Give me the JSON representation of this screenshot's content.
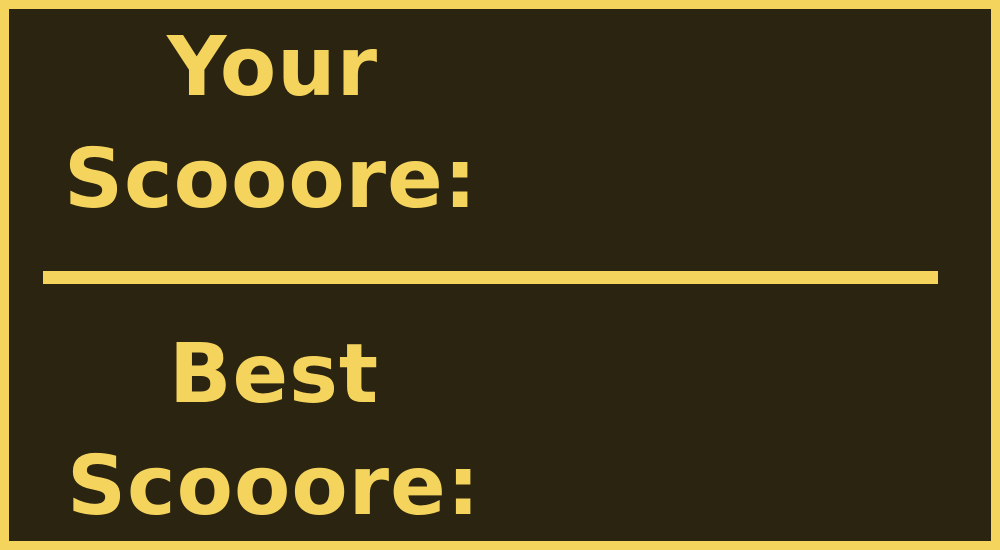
{
  "colors": {
    "background": "#2a2410",
    "accent": "#f5d45e"
  },
  "score_panel": {
    "your_score": {
      "line1": "Your",
      "line2": "Scooore:",
      "value": ""
    },
    "best_score": {
      "line1": "Best",
      "line2": "Scooore:",
      "value": ""
    }
  }
}
